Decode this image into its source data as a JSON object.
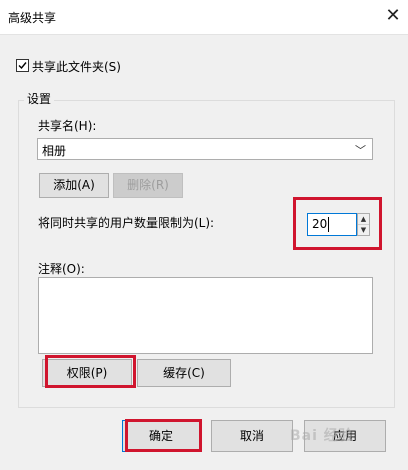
{
  "window": {
    "title": "高级共享"
  },
  "share_checkbox": {
    "label": "共享此文件夹(S)",
    "checked": true
  },
  "settings": {
    "group_title": "设置",
    "share_name_label": "共享名(H):",
    "share_name_value": "相册",
    "add_button": "添加(A)",
    "delete_button": "删除(R)",
    "user_limit_label": "将同时共享的用户数量限制为(L):",
    "user_limit_value": "20",
    "comment_label": "注释(O):",
    "comment_value": "",
    "permissions_button": "权限(P)",
    "caching_button": "缓存(C)"
  },
  "footer": {
    "ok_button": "确定",
    "cancel_button": "取消",
    "apply_button": "应用"
  },
  "watermark": "Bai 经验",
  "colors": {
    "highlight": "#d0152e",
    "focus": "#0078d7"
  }
}
